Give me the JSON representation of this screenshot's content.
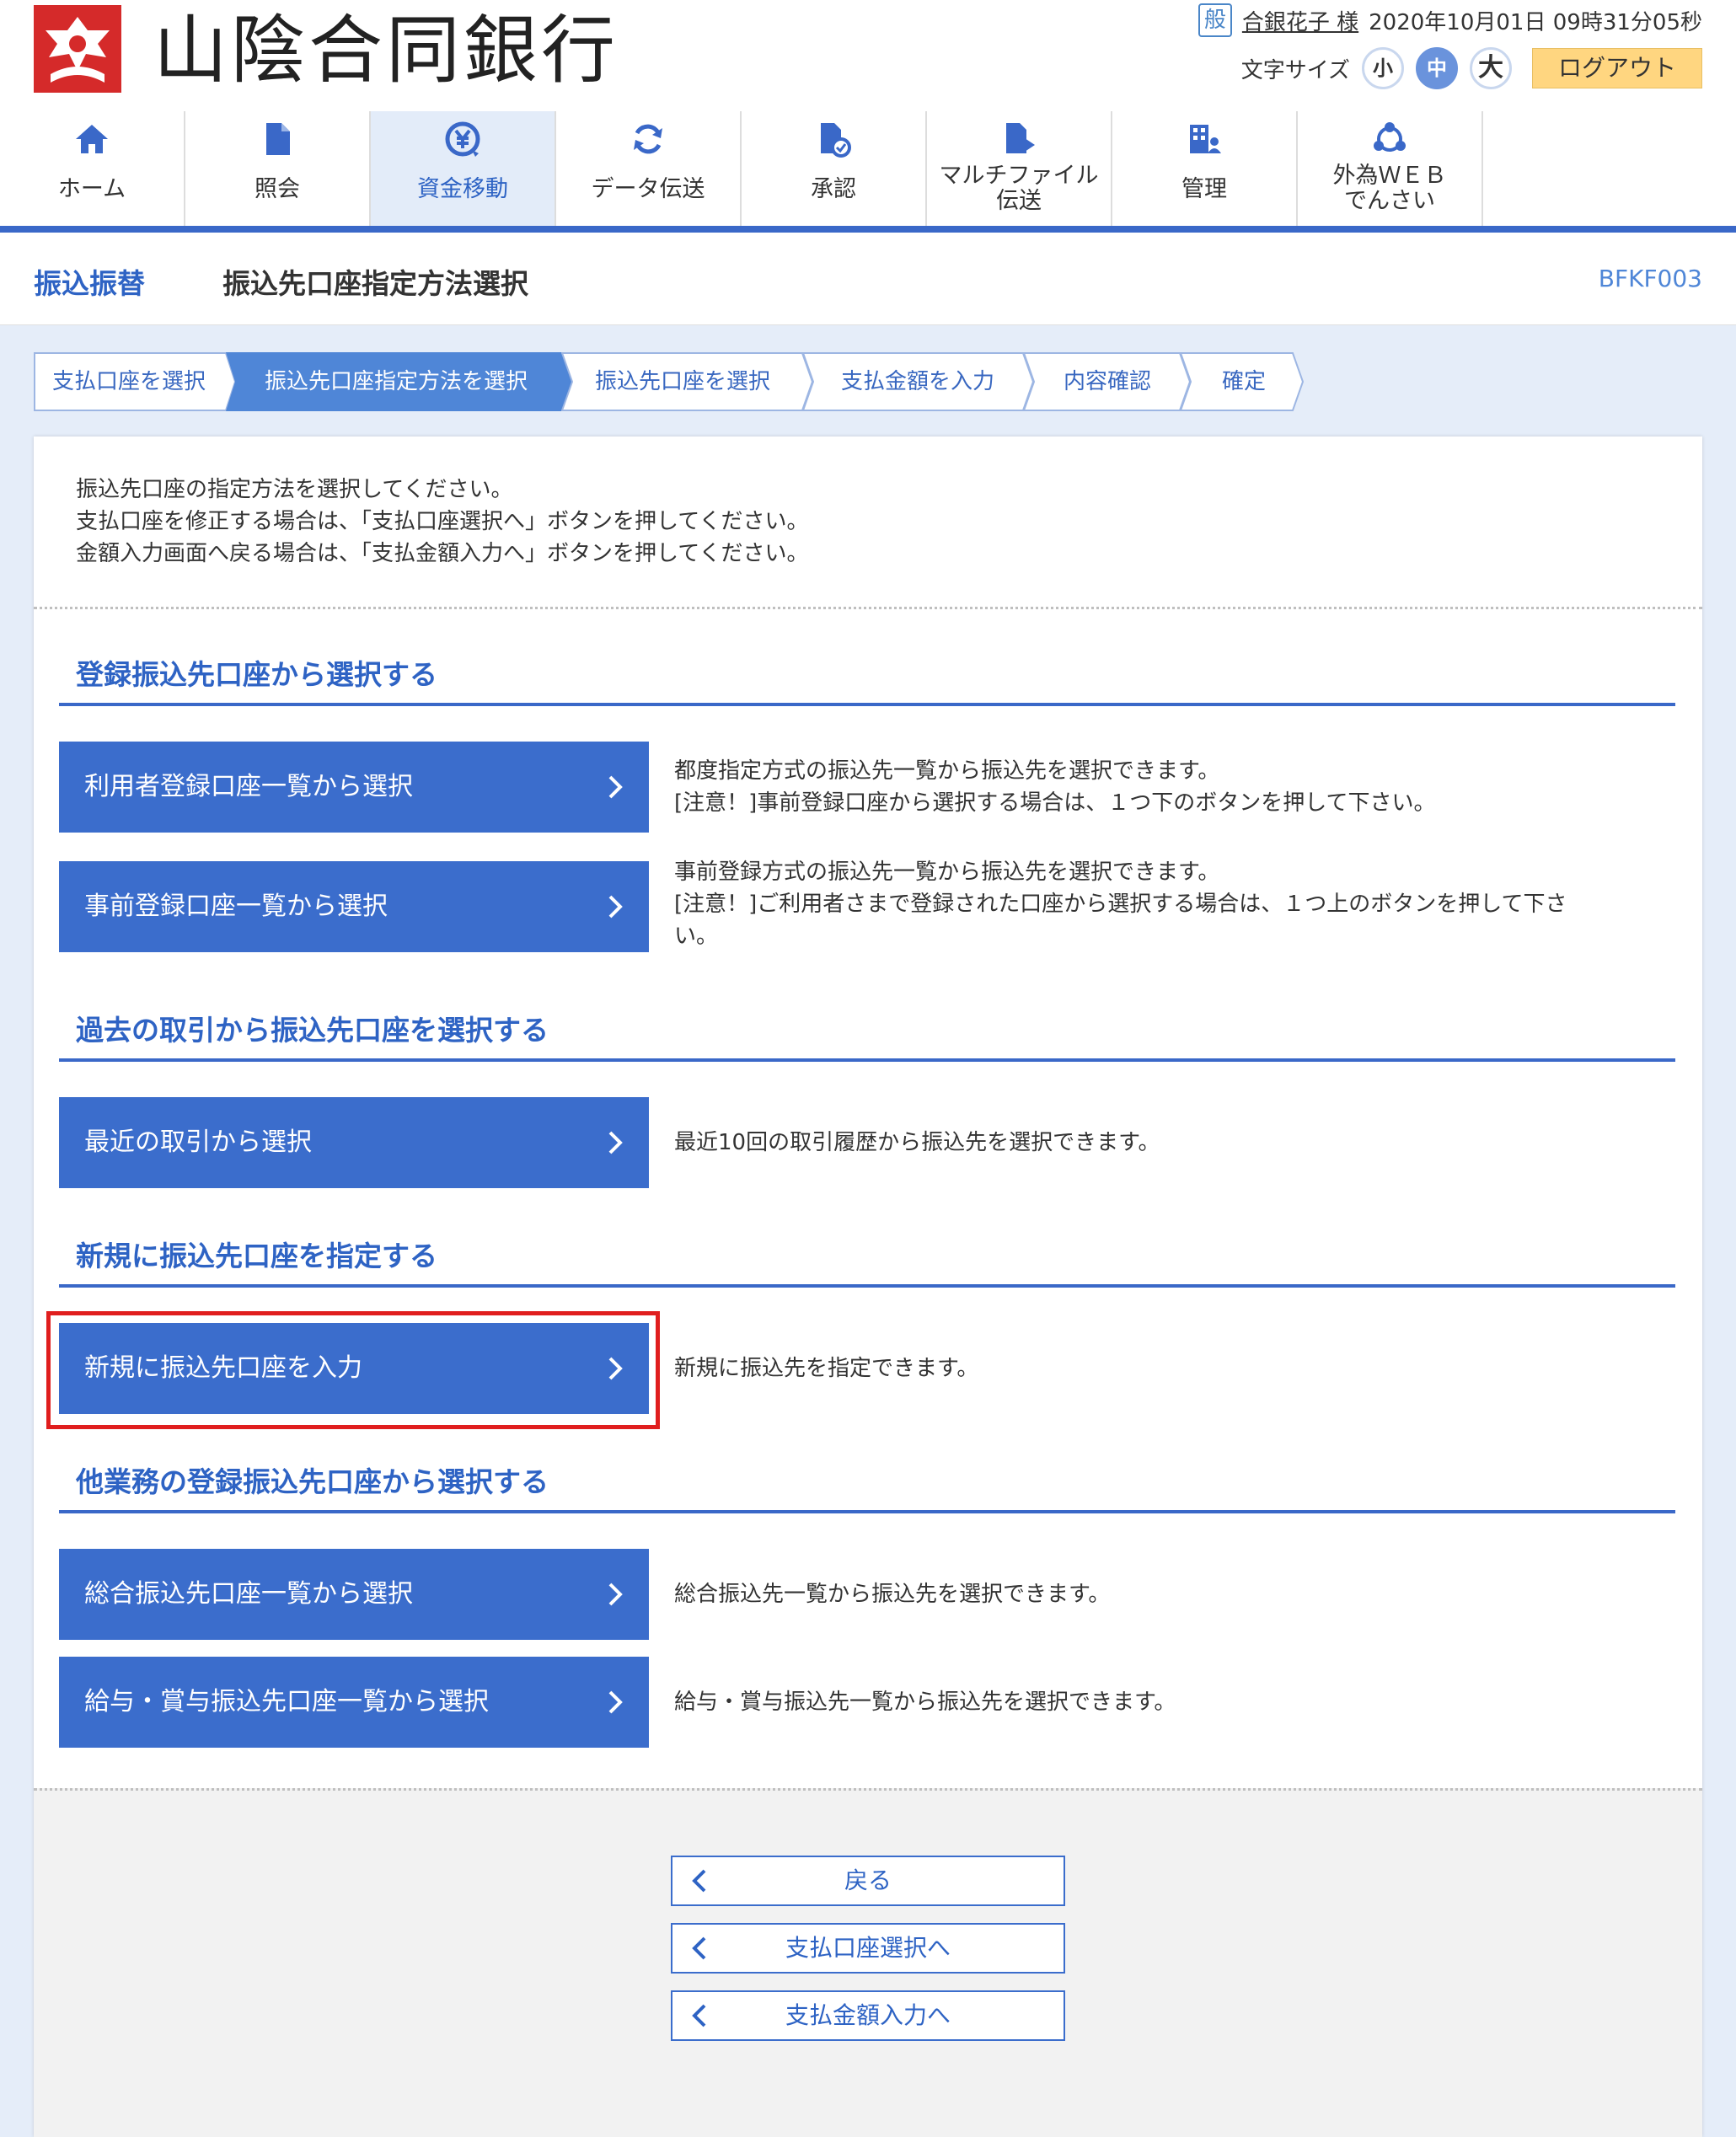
{
  "header": {
    "bank_name": "山陰合同銀行",
    "user_badge": "般",
    "user_name": "合銀花子 様",
    "datetime": "2020年10月01日 09時31分05秒",
    "font_size_label": "文字サイズ",
    "font_sizes": [
      "小",
      "中",
      "大"
    ],
    "font_size_selected": "中",
    "logout_label": "ログアウト"
  },
  "nav": {
    "items": [
      {
        "label": "ホーム",
        "icon": "home-icon"
      },
      {
        "label": "照会",
        "icon": "document-icon"
      },
      {
        "label": "資金移動",
        "icon": "yen-transfer-icon"
      },
      {
        "label": "データ伝送",
        "icon": "refresh-icon"
      },
      {
        "label": "承認",
        "icon": "approve-icon"
      },
      {
        "label_line1": "マルチファイル",
        "label_line2": "伝送",
        "icon": "file-upload-icon"
      },
      {
        "label": "管理",
        "icon": "admin-icon"
      },
      {
        "label_line1": "外為ＷＥＢ",
        "label_line2": "でんさい",
        "icon": "network-icon"
      }
    ],
    "active": "資金移動",
    "accent_color": "#3a68c8"
  },
  "page": {
    "category": "振込振替",
    "title": "振込先口座指定方法選択",
    "screen_id": "BFKF003"
  },
  "steps": [
    "支払口座を選択",
    "振込先口座指定方法を選択",
    "振込先口座を選択",
    "支払金額を入力",
    "内容確認",
    "確定"
  ],
  "current_step": "振込先口座指定方法を選択",
  "intro": [
    "振込先口座の指定方法を選択してください。",
    "支払口座を修正する場合は、「支払口座選択へ」ボタンを押してください。",
    "金額入力画面へ戻る場合は、「支払金額入力へ」ボタンを押してください。"
  ],
  "sections": {
    "registered": {
      "title": "登録振込先口座から選択する",
      "btn1": "利用者登録口座一覧から選択",
      "desc1_line1": "都度指定方式の振込先一覧から振込先を選択できます。",
      "desc1_line2": "[注意！]事前登録口座から選択する場合は、１つ下のボタンを押して下さい。",
      "btn2": "事前登録口座一覧から選択",
      "desc2_line1": "事前登録方式の振込先一覧から振込先を選択できます。",
      "desc2_line2": "[注意！]ご利用者さまで登録された口座から選択する場合は、１つ上のボタンを押して下さ",
      "desc2_line3": "い。"
    },
    "past": {
      "title": "過去の取引から振込先口座を選択する",
      "btn1": "最近の取引から選択",
      "desc1": "最近10回の取引履歴から振込先を選択できます。"
    },
    "new": {
      "title": "新規に振込先口座を指定する",
      "btn1": "新規に振込先口座を入力",
      "desc1": "新規に振込先を指定できます。"
    },
    "other": {
      "title": "他業務の登録振込先口座から選択する",
      "btn1": "総合振込先口座一覧から選択",
      "desc1": "総合振込先一覧から振込先を選択できます。",
      "btn2": "給与・賞与振込先口座一覧から選択",
      "desc2": "給与・賞与振込先一覧から振込先を選択できます。"
    }
  },
  "bottom_buttons": {
    "back": "戻る",
    "to_payment_account": "支払口座選択へ",
    "to_amount": "支払金額入力へ"
  },
  "colors": {
    "button_blue": "#3b6dcc",
    "highlight_red": "#e01e1e",
    "logout_bg": "#ffd680"
  }
}
